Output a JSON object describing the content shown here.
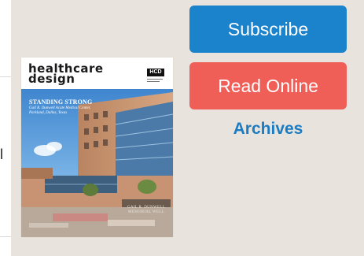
{
  "sidebar_fragment": {
    "cutoff_text": "l"
  },
  "cover": {
    "masthead_line1": "healthcare",
    "masthead_line2": "design",
    "badge": "HCD",
    "headline": "STANDING STRONG",
    "subheadline": "Gail R. Dunwell Acute Medical Center, Parkland, Dallas, Texas",
    "building_sign": "GAIL R. DUNWELL MEMORIAL WELL"
  },
  "actions": {
    "subscribe_label": "Subscribe",
    "read_online_label": "Read Online",
    "archives_label": "Archives"
  },
  "colors": {
    "panel_bg": "#e8e4dd",
    "subscribe_bg": "#1b82cc",
    "read_online_bg": "#f05f57",
    "archives_link": "#1b7cc4"
  }
}
